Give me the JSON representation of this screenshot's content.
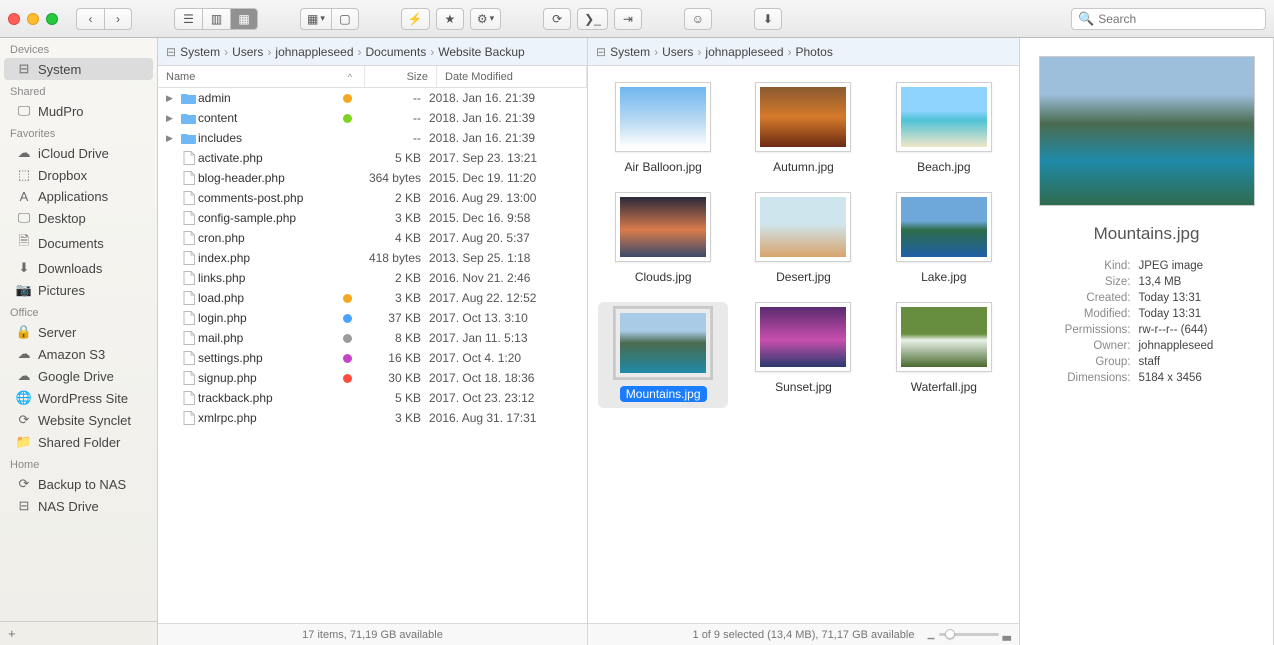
{
  "search_placeholder": "Search",
  "sidebar": {
    "groups": [
      {
        "label": "Devices",
        "items": [
          {
            "label": "System",
            "icon": "drive",
            "selected": true
          }
        ]
      },
      {
        "label": "Shared",
        "items": [
          {
            "label": "MudPro",
            "icon": "monitor"
          }
        ]
      },
      {
        "label": "Favorites",
        "items": [
          {
            "label": "iCloud Drive",
            "icon": "cloud"
          },
          {
            "label": "Dropbox",
            "icon": "dropbox"
          },
          {
            "label": "Applications",
            "icon": "apps"
          },
          {
            "label": "Desktop",
            "icon": "desktop"
          },
          {
            "label": "Documents",
            "icon": "doc"
          },
          {
            "label": "Downloads",
            "icon": "download"
          },
          {
            "label": "Pictures",
            "icon": "camera"
          }
        ]
      },
      {
        "label": "Office",
        "items": [
          {
            "label": "Server",
            "icon": "lock"
          },
          {
            "label": "Amazon S3",
            "icon": "cloud"
          },
          {
            "label": "Google Drive",
            "icon": "cloud"
          },
          {
            "label": "WordPress Site",
            "icon": "globe"
          },
          {
            "label": "Website Synclet",
            "icon": "sync"
          },
          {
            "label": "Shared Folder",
            "icon": "folder"
          }
        ]
      },
      {
        "label": "Home",
        "items": [
          {
            "label": "Backup to NAS",
            "icon": "sync"
          },
          {
            "label": "NAS Drive",
            "icon": "drive"
          }
        ]
      }
    ]
  },
  "pane1": {
    "breadcrumbs": [
      "System",
      "Users",
      "johnappleseed",
      "Documents",
      "Website Backup"
    ],
    "columns": {
      "name": "Name",
      "size": "Size",
      "date": "Date Modified"
    },
    "files": [
      {
        "name": "admin",
        "folder": true,
        "tag": "#f5a623",
        "size": "--",
        "date": "2018. Jan 16. 21:39"
      },
      {
        "name": "content",
        "folder": true,
        "tag": "#7ed321",
        "size": "--",
        "date": "2018. Jan 16. 21:39"
      },
      {
        "name": "includes",
        "folder": true,
        "tag": null,
        "size": "--",
        "date": "2018. Jan 16. 21:39"
      },
      {
        "name": "activate.php",
        "folder": false,
        "tag": null,
        "size": "5 KB",
        "date": "2017. Sep 23. 13:21"
      },
      {
        "name": "blog-header.php",
        "folder": false,
        "tag": null,
        "size": "364 bytes",
        "date": "2015. Dec 19. 11:20"
      },
      {
        "name": "comments-post.php",
        "folder": false,
        "tag": null,
        "size": "2 KB",
        "date": "2016. Aug 29. 13:00"
      },
      {
        "name": "config-sample.php",
        "folder": false,
        "tag": null,
        "size": "3 KB",
        "date": "2015. Dec 16. 9:58"
      },
      {
        "name": "cron.php",
        "folder": false,
        "tag": null,
        "size": "4 KB",
        "date": "2017. Aug 20. 5:37"
      },
      {
        "name": "index.php",
        "folder": false,
        "tag": null,
        "size": "418 bytes",
        "date": "2013. Sep 25. 1:18"
      },
      {
        "name": "links.php",
        "folder": false,
        "tag": null,
        "size": "2 KB",
        "date": "2016. Nov 21. 2:46"
      },
      {
        "name": "load.php",
        "folder": false,
        "tag": "#f5a623",
        "size": "3 KB",
        "date": "2017. Aug 22. 12:52"
      },
      {
        "name": "login.php",
        "folder": false,
        "tag": "#4aa3ff",
        "size": "37 KB",
        "date": "2017. Oct 13. 3:10"
      },
      {
        "name": "mail.php",
        "folder": false,
        "tag": "#9b9b9b",
        "size": "8 KB",
        "date": "2017. Jan 11. 5:13"
      },
      {
        "name": "settings.php",
        "folder": false,
        "tag": "#c644c6",
        "size": "16 KB",
        "date": "2017. Oct 4. 1:20"
      },
      {
        "name": "signup.php",
        "folder": false,
        "tag": "#ff4b3e",
        "size": "30 KB",
        "date": "2017. Oct 18. 18:36"
      },
      {
        "name": "trackback.php",
        "folder": false,
        "tag": null,
        "size": "5 KB",
        "date": "2017. Oct 23. 23:12"
      },
      {
        "name": "xmlrpc.php",
        "folder": false,
        "tag": null,
        "size": "3 KB",
        "date": "2016. Aug 31. 17:31"
      }
    ],
    "status": "17 items, 71,19 GB available"
  },
  "pane2": {
    "breadcrumbs": [
      "System",
      "Users",
      "johnappleseed",
      "Photos"
    ],
    "thumbs": [
      {
        "label": "Air Balloon.jpg",
        "bg": "linear-gradient(#6fb6f0,#bedcf3 60%,#fff)"
      },
      {
        "label": "Autumn.jpg",
        "bg": "linear-gradient(#8a5a2e,#d67a2c 50%,#6b2a12)"
      },
      {
        "label": "Beach.jpg",
        "bg": "linear-gradient(#8fd3ff 40%,#4fc2d6 55%,#f1e7c9)"
      },
      {
        "label": "Clouds.jpg",
        "bg": "linear-gradient(#2a2a3a,#d97b4b 55%,#3a4a6a)"
      },
      {
        "label": "Desert.jpg",
        "bg": "linear-gradient(#cfe5ee 45%,#d9a36b)"
      },
      {
        "label": "Lake.jpg",
        "bg": "linear-gradient(#6ea7d9 40%,#2e6d4a 55%,#1f5fa8)"
      },
      {
        "label": "Mountains.jpg",
        "bg": "linear-gradient(#aacbe6 30%,#4a6b4f 50%,#1f8aa8)",
        "selected": true
      },
      {
        "label": "Sunset.jpg",
        "bg": "linear-gradient(#5a2a6e,#c84fae 55%,#2a3a6e)"
      },
      {
        "label": "Waterfall.jpg",
        "bg": "linear-gradient(#678d3f 45%,#e8f2e8 55%,#4a6b2f)"
      }
    ],
    "status": "1 of 9 selected (13,4 MB), 71,17 GB available"
  },
  "pane3": {
    "title": "Mountains.jpg",
    "preview_bg": "linear-gradient(#9dbfdc 25%,#4a6b4f 45%,#1f8aa8 70%,#2f6b4f)",
    "meta": [
      {
        "k": "Kind:",
        "v": "JPEG image"
      },
      {
        "k": "Size:",
        "v": "13,4 MB"
      },
      {
        "k": "Created:",
        "v": "Today 13:31"
      },
      {
        "k": "Modified:",
        "v": "Today 13:31"
      },
      {
        "k": "Permissions:",
        "v": "rw-r--r-- (644)"
      },
      {
        "k": "Owner:",
        "v": "johnappleseed"
      },
      {
        "k": "Group:",
        "v": "staff"
      },
      {
        "k": "Dimensions:",
        "v": "5184 x 3456"
      }
    ]
  }
}
